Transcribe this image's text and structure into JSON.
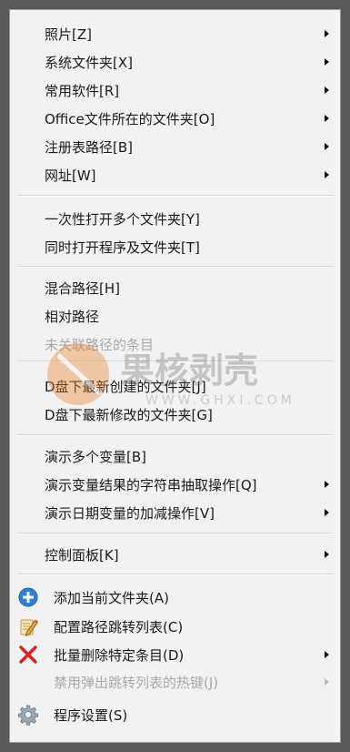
{
  "menu": {
    "items": [
      {
        "label": "照片[Z]",
        "submenu": true
      },
      {
        "label": "系统文件夹[X]",
        "submenu": true
      },
      {
        "label": "常用软件[R]",
        "submenu": true
      },
      {
        "label": "Office文件所在的文件夹[O]",
        "submenu": true
      },
      {
        "label": "注册表路径[B]",
        "submenu": true
      },
      {
        "label": "网址[W]",
        "submenu": true
      },
      {
        "label": "一次性打开多个文件夹[Y]",
        "submenu": false
      },
      {
        "label": "同时打开程序及文件夹[T]",
        "submenu": false
      },
      {
        "label": "混合路径[H]",
        "submenu": false
      },
      {
        "label": "相对路径",
        "submenu": false
      },
      {
        "label": "未关联路径的条目",
        "submenu": false,
        "disabled": true
      },
      {
        "label": "D盘下最新创建的文件夹[J]",
        "submenu": false
      },
      {
        "label": "D盘下最新修改的文件夹[G]",
        "submenu": false
      },
      {
        "label": "演示多个变量[B]",
        "submenu": false
      },
      {
        "label": "演示变量结果的字符串抽取操作[Q]",
        "submenu": true
      },
      {
        "label": "演示日期变量的加减操作[V]",
        "submenu": true
      },
      {
        "label": "控制面板[K]",
        "submenu": true
      },
      {
        "label": "添加当前文件夹(A)",
        "icon": "add-folder-icon"
      },
      {
        "label": "配置路径跳转列表(C)",
        "icon": "edit-list-icon"
      },
      {
        "label": "批量删除特定条目(D)",
        "icon": "delete-x-icon",
        "submenu": true
      },
      {
        "label": "禁用弹出跳转列表的热键(J)",
        "submenu": true,
        "disabled": true
      },
      {
        "label": "程序设置(S)",
        "icon": "gear-icon"
      }
    ]
  },
  "colors": {
    "menu_bg": "#f2f2f2",
    "backdrop": "#585858",
    "disabled_text": "#a8a8a8",
    "add_icon": "#2f7fd0",
    "delete_icon": "#e02020"
  },
  "watermark": {
    "text": "果核剥壳",
    "url": "WWW.GHXI.COM"
  }
}
